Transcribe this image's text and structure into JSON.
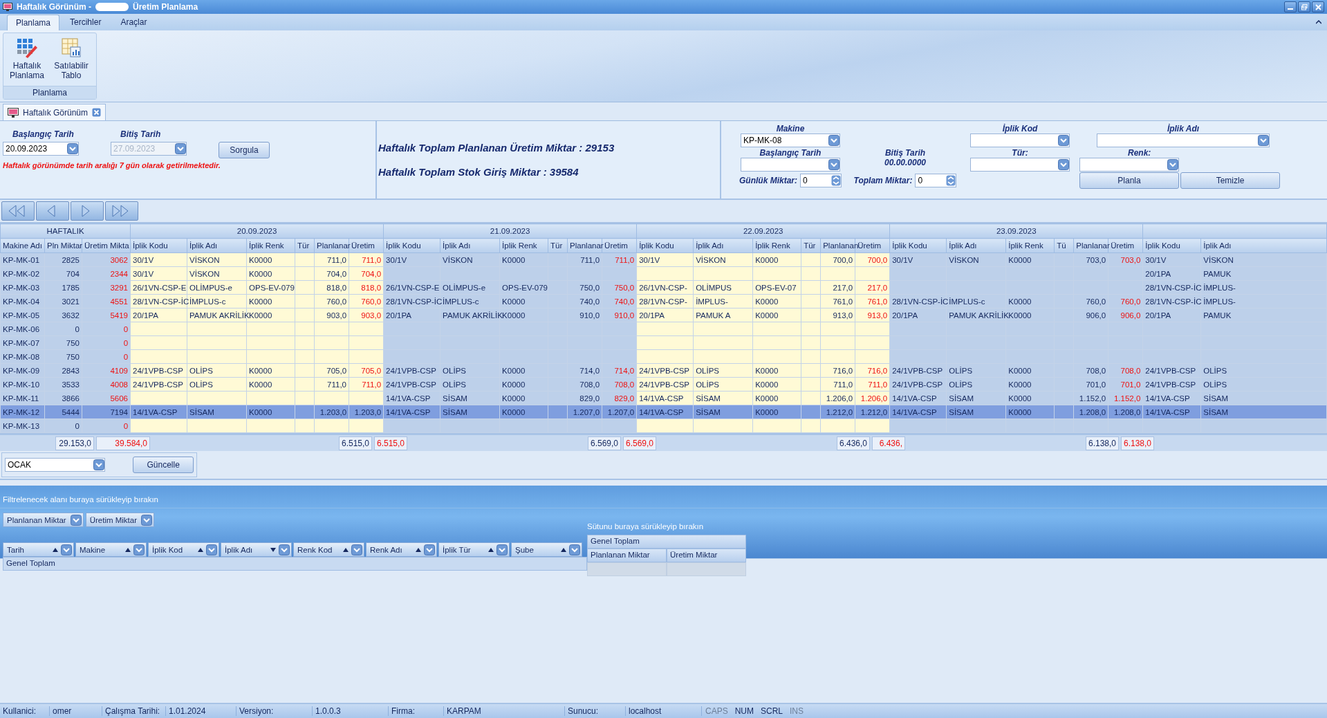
{
  "window": {
    "title_start": "Haftalık Görünüm -",
    "title_end": "Üretim Planlama"
  },
  "ribbon": {
    "tabs": [
      {
        "label": "Planlama",
        "selected": true
      },
      {
        "label": "Tercihler",
        "selected": false
      },
      {
        "label": "Araçlar",
        "selected": false
      }
    ],
    "buttons": [
      {
        "label": "Haftalık Planlama",
        "kind": "weekly"
      },
      {
        "label": "Satılabilir Tablo",
        "kind": "table"
      }
    ],
    "group": "Planlama"
  },
  "document_tab": {
    "label": "Haftalık Görünüm"
  },
  "query": {
    "start_label": "Başlangıç Tarih",
    "end_label": "Bitiş Tarih",
    "start_value": "20.09.2023",
    "end_value": "27.09.2023",
    "end_disabled": true,
    "button": "Sorgula",
    "note": "Haftalık görünümde tarih aralığı 7 gün olarak getirilmektedir."
  },
  "summary": [
    "Haftalık Toplam Planlanan Üretim Miktar : 29153",
    "Haftalık Toplam Stok Giriş Miktar : 39584"
  ],
  "planning": {
    "machine_label": "Makine",
    "machine_value": "KP-MK-08",
    "start_label": "Başlangıç Tarih",
    "end_label": "Bitiş Tarih",
    "end_value": "00.00.0000",
    "daily_label": "Günlük Miktar:",
    "daily_value": "0",
    "total_label": "Toplam Miktar:",
    "total_value": "0",
    "yarn_code_label": "İplik Kod",
    "yarn_name_label": "İplik Adı",
    "type_label": "Tür:",
    "color_label": "Renk:",
    "buttons": [
      "Planla",
      "Temizle"
    ]
  },
  "grid": {
    "fixed_group": "HAFTALIK",
    "fixed_columns": [
      "Makine Adı",
      "Pln Miktar",
      "Üretim Mikta"
    ],
    "days": [
      {
        "date": "20.09.2023",
        "columns": [
          "İplik Kodu",
          "İplik Adı",
          "İplik Renk",
          "Tür",
          "Planlanar",
          "Üretim"
        ]
      },
      {
        "date": "21.09.2023",
        "columns": [
          "İplik Kodu",
          "İplik Adı",
          "İplik Renk",
          "Tür",
          "Planlanar",
          "Üretim"
        ]
      },
      {
        "date": "22.09.2023",
        "columns": [
          "İplik Kodu",
          "İplik Adı",
          "İplik Renk",
          "Tür",
          "Planlanan",
          "Üretim"
        ]
      },
      {
        "date": "23.09.2023",
        "columns": [
          "İplik Kodu",
          "İplik Adı",
          "İplik Renk",
          "Tü",
          "Planlanar",
          "Üretim"
        ]
      },
      {
        "columns": [
          "İplik Kodu",
          "İplik Adı"
        ]
      }
    ],
    "rows": [
      {
        "machine": "KP-MK-01",
        "planned": "2825",
        "produced": "3062",
        "selected": false,
        "days": [
          {
            "kind": "plan",
            "code": "30/1V",
            "name": "VİSKON",
            "yarn_color": "K0000",
            "planned": "711,0",
            "produced": "711,0"
          },
          {
            "kind": "plan",
            "code": "30/1V",
            "name": "VİSKON",
            "yarn_color": "K0000",
            "planned": "711,0",
            "produced": "711,0"
          },
          {
            "kind": "plan",
            "code": "30/1V",
            "name": "VİSKON",
            "yarn_color": "K0000",
            "planned": "700,0",
            "produced": "700,0"
          },
          {
            "kind": "plan",
            "code": "30/1V",
            "name": "VİSKON",
            "yarn_color": "K0000",
            "planned": "703,0",
            "produced": "703,0"
          },
          {
            "kind": "plan",
            "code": "30/1V",
            "name": "VİSKON"
          }
        ]
      },
      {
        "machine": "KP-MK-02",
        "planned": "704",
        "produced": "2344",
        "selected": false,
        "days": [
          {
            "kind": "plan",
            "code": "30/1V",
            "name": "VİSKON",
            "yarn_color": "K0000",
            "planned": "704,0",
            "produced": "704,0"
          },
          {
            "kind": "blank"
          },
          {
            "kind": "blank"
          },
          {
            "kind": "blank"
          },
          {
            "kind": "plan",
            "code": "20/1PA",
            "name": "PAMUK"
          }
        ]
      },
      {
        "machine": "KP-MK-03",
        "planned": "1785",
        "produced": "3291",
        "selected": false,
        "days": [
          {
            "kind": "plan",
            "code": "26/1VN-CSP-E",
            "name": "OLİMPUS-e",
            "yarn_color": "OPS-EV-079",
            "planned": "818,0",
            "produced": "818,0"
          },
          {
            "kind": "plan",
            "code": "26/1VN-CSP-E",
            "name": "OLİMPUS-e",
            "yarn_color": "OPS-EV-079",
            "planned": "750,0",
            "produced": "750,0"
          },
          {
            "kind": "plan",
            "code": "26/1VN-CSP-",
            "name": "OLİMPUS",
            "yarn_color": "OPS-EV-07",
            "planned": "217,0",
            "produced": "217,0"
          },
          {
            "kind": "blank"
          },
          {
            "kind": "plan",
            "code": "28/1VN-CSP-İC",
            "name": "İMPLUS-"
          }
        ]
      },
      {
        "machine": "KP-MK-04",
        "planned": "3021",
        "produced": "4551",
        "selected": false,
        "days": [
          {
            "kind": "plan",
            "code": "28/1VN-CSP-İC",
            "name": "İMPLUS-c",
            "yarn_color": "K0000",
            "planned": "760,0",
            "produced": "760,0"
          },
          {
            "kind": "plan",
            "code": "28/1VN-CSP-İC",
            "name": "İMPLUS-c",
            "yarn_color": "K0000",
            "planned": "740,0",
            "produced": "740,0"
          },
          {
            "kind": "plan",
            "code": "28/1VN-CSP-",
            "name": "İMPLUS-",
            "yarn_color": "K0000",
            "planned": "761,0",
            "produced": "761,0"
          },
          {
            "kind": "plan",
            "code": "28/1VN-CSP-İC",
            "name": "İMPLUS-c",
            "yarn_color": "K0000",
            "planned": "760,0",
            "produced": "760,0"
          },
          {
            "kind": "plan",
            "code": "28/1VN-CSP-İC",
            "name": "İMPLUS-"
          }
        ]
      },
      {
        "machine": "KP-MK-05",
        "planned": "3632",
        "produced": "5419",
        "selected": false,
        "days": [
          {
            "kind": "plan",
            "code": "20/1PA",
            "name": "PAMUK AKRİLİK",
            "yarn_color": "K0000",
            "planned": "903,0",
            "produced": "903,0"
          },
          {
            "kind": "plan",
            "code": "20/1PA",
            "name": "PAMUK AKRİLİK",
            "yarn_color": "K0000",
            "planned": "910,0",
            "produced": "910,0"
          },
          {
            "kind": "plan",
            "code": "20/1PA",
            "name": "PAMUK A",
            "yarn_color": "K0000",
            "planned": "913,0",
            "produced": "913,0"
          },
          {
            "kind": "plan",
            "code": "20/1PA",
            "name": "PAMUK AKRİLİK",
            "yarn_color": "K0000",
            "planned": "906,0",
            "produced": "906,0"
          },
          {
            "kind": "plan",
            "code": "20/1PA",
            "name": "PAMUK"
          }
        ]
      },
      {
        "machine": "KP-MK-06",
        "planned": "0",
        "produced": "0",
        "selected": false,
        "days": [
          {
            "kind": "blank"
          },
          {
            "kind": "blank"
          },
          {
            "kind": "blank"
          },
          {
            "kind": "blank"
          },
          {
            "kind": "blank"
          }
        ]
      },
      {
        "machine": "KP-MK-07",
        "planned": "750",
        "produced": "0",
        "selected": false,
        "days": [
          {
            "kind": "blank"
          },
          {
            "kind": "blank"
          },
          {
            "kind": "blank"
          },
          {
            "kind": "blank"
          },
          {
            "kind": "blank"
          }
        ]
      },
      {
        "machine": "KP-MK-08",
        "planned": "750",
        "produced": "0",
        "selected": false,
        "days": [
          {
            "kind": "blank"
          },
          {
            "kind": "blank"
          },
          {
            "kind": "blank"
          },
          {
            "kind": "blank"
          },
          {
            "kind": "blank"
          }
        ]
      },
      {
        "machine": "KP-MK-09",
        "planned": "2843",
        "produced": "4109",
        "selected": false,
        "days": [
          {
            "kind": "plan",
            "code": "24/1VPB-CSP",
            "name": "OLİPS",
            "yarn_color": "K0000",
            "planned": "705,0",
            "produced": "705,0"
          },
          {
            "kind": "plan",
            "code": "24/1VPB-CSP",
            "name": "OLİPS",
            "yarn_color": "K0000",
            "planned": "714,0",
            "produced": "714,0"
          },
          {
            "kind": "plan",
            "code": "24/1VPB-CSP",
            "name": "OLİPS",
            "yarn_color": "K0000",
            "planned": "716,0",
            "produced": "716,0"
          },
          {
            "kind": "plan",
            "code": "24/1VPB-CSP",
            "name": "OLİPS",
            "yarn_color": "K0000",
            "planned": "708,0",
            "produced": "708,0"
          },
          {
            "kind": "plan",
            "code": "24/1VPB-CSP",
            "name": "OLİPS"
          }
        ]
      },
      {
        "machine": "KP-MK-10",
        "planned": "3533",
        "produced": "4008",
        "selected": false,
        "days": [
          {
            "kind": "plan",
            "code": "24/1VPB-CSP",
            "name": "OLİPS",
            "yarn_color": "K0000",
            "planned": "711,0",
            "produced": "711,0"
          },
          {
            "kind": "plan",
            "code": "24/1VPB-CSP",
            "name": "OLİPS",
            "yarn_color": "K0000",
            "planned": "708,0",
            "produced": "708,0"
          },
          {
            "kind": "plan",
            "code": "24/1VPB-CSP",
            "name": "OLİPS",
            "yarn_color": "K0000",
            "planned": "711,0",
            "produced": "711,0"
          },
          {
            "kind": "plan",
            "code": "24/1VPB-CSP",
            "name": "OLİPS",
            "yarn_color": "K0000",
            "planned": "701,0",
            "produced": "701,0"
          },
          {
            "kind": "plan",
            "code": "24/1VPB-CSP",
            "name": "OLİPS"
          }
        ]
      },
      {
        "machine": "KP-MK-11",
        "planned": "3866",
        "produced": "5606",
        "selected": false,
        "days": [
          {
            "kind": "blank"
          },
          {
            "kind": "plan",
            "code": "14/1VA-CSP",
            "name": "SİSAM",
            "yarn_color": "K0000",
            "planned": "829,0",
            "produced": "829,0"
          },
          {
            "kind": "plan",
            "code": "14/1VA-CSP",
            "name": "SİSAM",
            "yarn_color": "K0000",
            "planned": "1.206,0",
            "produced": "1.206,0"
          },
          {
            "kind": "plan",
            "code": "14/1VA-CSP",
            "name": "SİSAM",
            "yarn_color": "K0000",
            "planned": "1.152,0",
            "produced": "1.152,0"
          },
          {
            "kind": "plan",
            "code": "14/1VA-CSP",
            "name": "SİSAM"
          }
        ]
      },
      {
        "machine": "KP-MK-12",
        "planned": "5444",
        "produced": "7194",
        "selected": true,
        "days": [
          {
            "kind": "plan",
            "code": "14/1VA-CSP",
            "name": "SİSAM",
            "yarn_color": "K0000",
            "planned": "1.203,0",
            "produced": "1.203,0"
          },
          {
            "kind": "plan",
            "code": "14/1VA-CSP",
            "name": "SİSAM",
            "yarn_color": "K0000",
            "planned": "1.207,0",
            "produced": "1.207,0"
          },
          {
            "kind": "plan",
            "code": "14/1VA-CSP",
            "name": "SİSAM",
            "yarn_color": "K0000",
            "planned": "1.212,0",
            "produced": "1.212,0"
          },
          {
            "kind": "plan",
            "code": "14/1VA-CSP",
            "name": "SİSAM",
            "yarn_color": "K0000",
            "planned": "1.208,0",
            "produced": "1.208,0"
          },
          {
            "kind": "plan",
            "code": "14/1VA-CSP",
            "name": "SİSAM"
          }
        ]
      },
      {
        "machine": "KP-MK-13",
        "planned": "0",
        "produced": "0",
        "selected": false,
        "days": [
          {
            "kind": "blank"
          },
          {
            "kind": "blank"
          },
          {
            "kind": "blank"
          },
          {
            "kind": "blank"
          },
          {
            "kind": "blank"
          }
        ]
      }
    ],
    "totals": {
      "planned": "29.153,0",
      "produced": "39.584,0",
      "days": [
        {
          "planned": "6.515,0",
          "produced": "6.515,0"
        },
        {
          "planned": "6.569,0",
          "produced": "6.569,0"
        },
        {
          "planned": "6.436,0",
          "produced": "6.436,"
        },
        {
          "planned": "6.138,0",
          "produced": "6.138,0"
        }
      ]
    }
  },
  "update": {
    "combo": "OCAK",
    "button": "Güncelle"
  },
  "pivot": {
    "filter_hint": "Filtrelenecek alanı buraya sürükleyip bırakın",
    "data_fields": [
      "Planlanan Miktar",
      "Üretim Miktar"
    ],
    "row_fields": [
      {
        "label": "Tarih",
        "descending": false
      },
      {
        "label": "Makine",
        "descending": false
      },
      {
        "label": "İplik Kod",
        "descending": false
      },
      {
        "label": "İplik Adı",
        "descending": true
      },
      {
        "label": "Renk Kod",
        "descending": false
      },
      {
        "label": "Renk Adı",
        "descending": false
      },
      {
        "label": "İplik Tür",
        "descending": false
      },
      {
        "label": "Şube",
        "descending": false
      }
    ],
    "column_hint": "Sütunu buraya sürükleyip bırakın",
    "grand_total_column": "Genel Toplam",
    "value_columns": [
      "Planlanan Miktar",
      "Üretim Miktar"
    ],
    "grand_total_row": "Genel Toplam"
  },
  "status_bar": {
    "fields": [
      {
        "label": "Kullanici:",
        "value": "omer"
      },
      {
        "label": "Çalışma Tarihi:",
        "value": "1.01.2024"
      },
      {
        "label": "Versiyon:",
        "value": "1.0.0.3"
      },
      {
        "label": "Firma:",
        "value": "KARPAM"
      },
      {
        "label": "Sunucu:",
        "value": "localhost"
      }
    ],
    "indicators": [
      {
        "label": "CAPS",
        "on": false
      },
      {
        "label": "NUM",
        "on": true
      },
      {
        "label": "SCRL",
        "on": true
      },
      {
        "label": "INS",
        "on": false
      }
    ]
  }
}
